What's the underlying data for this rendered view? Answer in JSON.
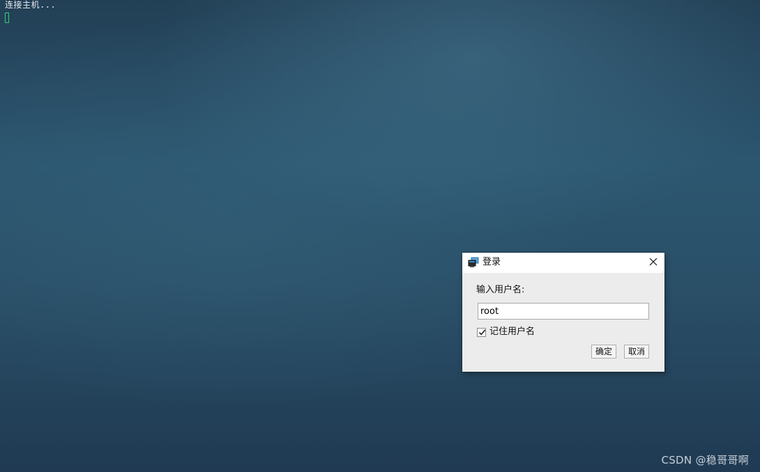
{
  "terminal": {
    "status_text": "连接主机..."
  },
  "dialog": {
    "title": "登录",
    "app_icon": "terminal-app-icon",
    "close_icon": "close-icon",
    "prompt_label": "输入用户名:",
    "username_value": "root",
    "remember_checked": true,
    "remember_label": "记住用户名",
    "ok_label": "确定",
    "cancel_label": "取消"
  },
  "watermark": {
    "text": "CSDN @稳哥哥啊"
  },
  "colors": {
    "desktop_background": "#2c5670",
    "cursor": "#2fd07a",
    "dialog_background": "#ececec",
    "titlebar_background": "#ffffff"
  }
}
